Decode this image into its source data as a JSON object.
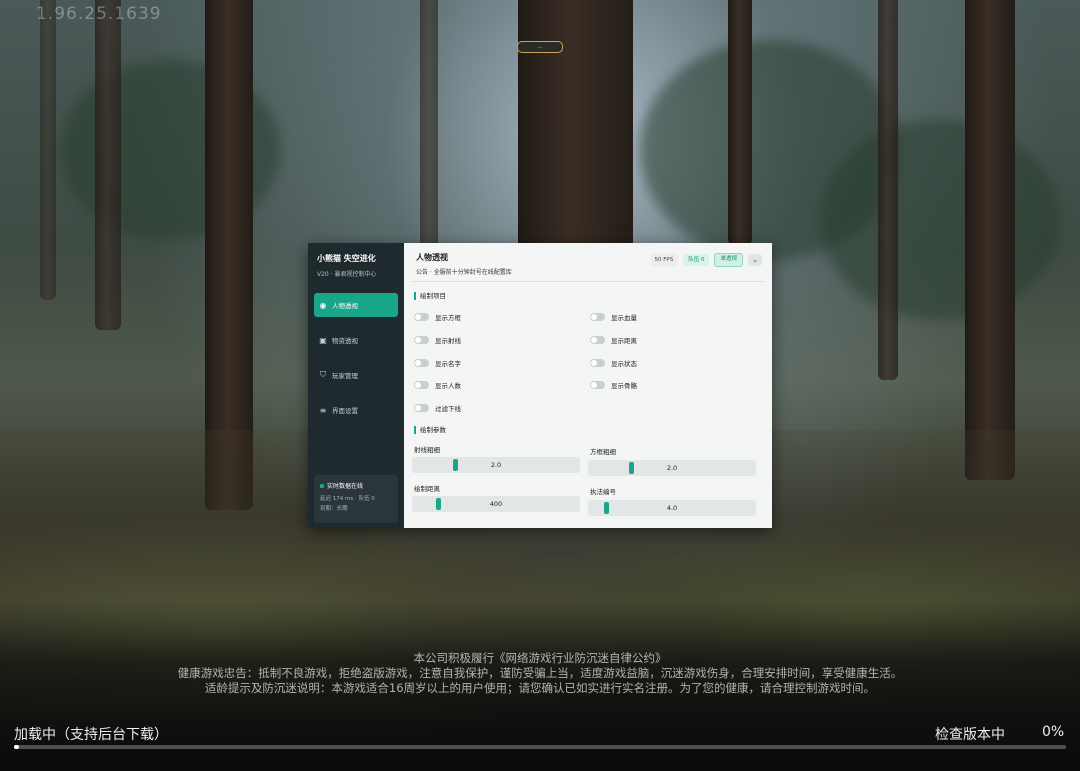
{
  "app": {
    "version": "1.96.25.1639",
    "top_pill": "..."
  },
  "menu": {
    "brand": "小熊猫 失空进化",
    "subtitle": "V20 · 暴君视控制中心",
    "nav": [
      {
        "label": "人物透视",
        "icon": "eye-icon",
        "active": true
      },
      {
        "label": "物资透视",
        "icon": "box-icon",
        "active": false
      },
      {
        "label": "玩家管理",
        "icon": "shield-icon",
        "active": false
      },
      {
        "label": "界面设置",
        "icon": "settings-icon",
        "active": false
      }
    ],
    "status": {
      "title": "实时数据在线",
      "line1": "延迟 174 ms · 队伍 0",
      "line2": "到期：长期"
    },
    "header": {
      "title": "人物透视",
      "notice": "公告 · 全服前十分钟封号在线配置库",
      "chips": [
        "50 FPS",
        "队伍 0",
        "单透视"
      ],
      "menu_glyph": "⌄"
    },
    "toggles_section": "绘制项目",
    "toggles": [
      {
        "label": "显示方框",
        "on": false
      },
      {
        "label": "显示血量",
        "on": false
      },
      {
        "label": "显示射线",
        "on": false
      },
      {
        "label": "显示距离",
        "on": false
      },
      {
        "label": "显示名字",
        "on": false
      },
      {
        "label": "显示状态",
        "on": false
      },
      {
        "label": "显示人数",
        "on": false
      },
      {
        "label": "显示骨骼",
        "on": false
      },
      {
        "label": "过滤下线",
        "on": false
      }
    ],
    "params_section": "绘制参数",
    "sliders": [
      {
        "label": "射线粗细",
        "value": "2.0",
        "level": 0.25
      },
      {
        "label": "方框粗细",
        "value": "2.0",
        "level": 0.25
      },
      {
        "label": "绘制距离",
        "value": "400",
        "level": 0.15
      },
      {
        "label": "执法编号",
        "value": "4.0",
        "level": 0.1
      }
    ]
  },
  "footer": {
    "line1": "本公司积极履行《网络游戏行业防沉迷自律公约》",
    "line2": "健康游戏忠告：抵制不良游戏，拒绝盗版游戏，注意自我保护，谨防受骗上当，适度游戏益脑，沉迷游戏伤身，合理安排时间，享受健康生活。",
    "line3": "适龄提示及防沉迷说明：本游戏适合16周岁以上的用户使用；请您确认已如实进行实名注册。为了您的健康，请合理控制游戏时间。",
    "loading_left": "加载中（支持后台下载）",
    "loading_right": "检查版本中",
    "percent": "0%",
    "progress": 0.005
  }
}
